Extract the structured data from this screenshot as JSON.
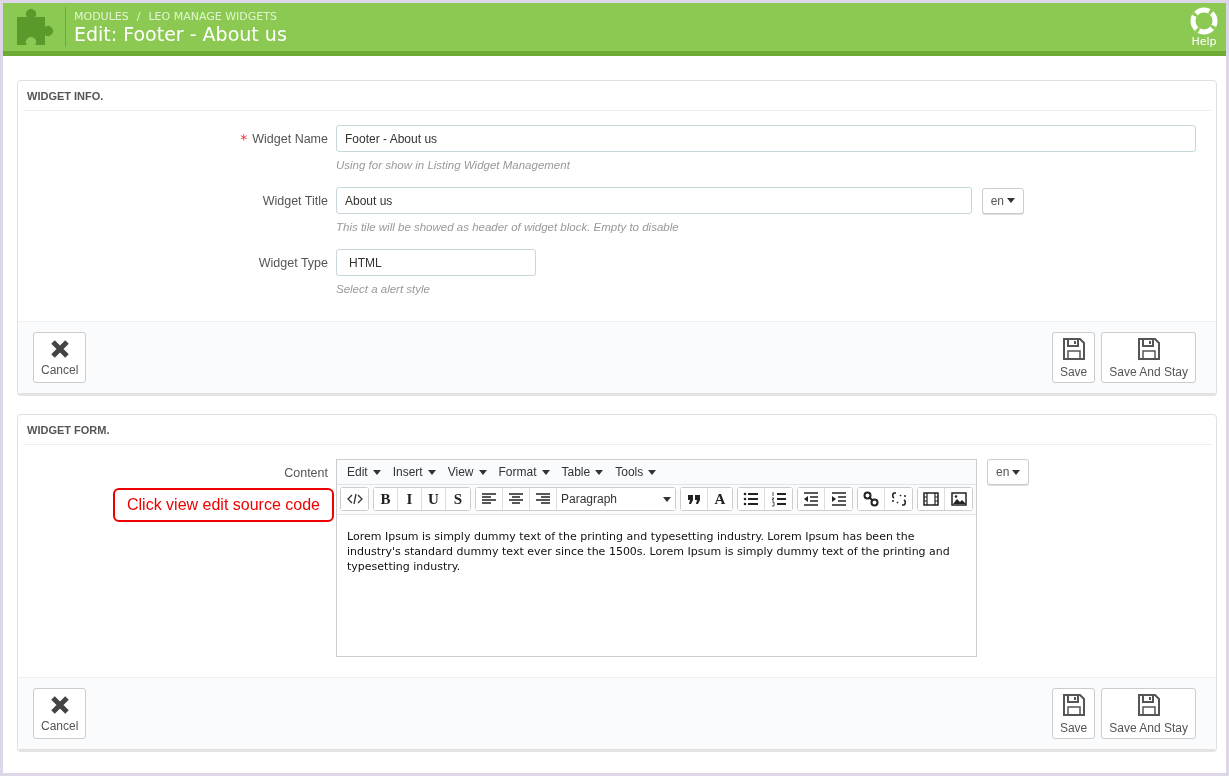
{
  "header": {
    "breadcrumb": [
      "MODULES",
      "LEO MANAGE WIDGETS"
    ],
    "separator": "/",
    "title": "Edit: Footer - About us",
    "help": "Help"
  },
  "panels": [
    {
      "heading": "WIDGET INFO.",
      "fields": [
        {
          "kind": "text",
          "label": "Widget Name",
          "required_mark": "*",
          "value": "Footer - About us",
          "hint": "Using for show in Listing Widget Management"
        },
        {
          "kind": "lang",
          "label": "Widget Title",
          "value": "About us",
          "lang": "en",
          "hint": "This tile will be showed as header of widget block. Empty to disable"
        },
        {
          "kind": "select",
          "label": "Widget Type",
          "value": "HTML",
          "hint": "Select a alert style"
        }
      ],
      "footer": {
        "cancel": "Cancel",
        "save": "Save",
        "save_stay": "Save And Stay"
      }
    },
    {
      "heading": "WIDGET FORM.",
      "fields": [
        {
          "kind": "editor",
          "label": "Content",
          "lang": "en",
          "menus": [
            "Edit",
            "Insert",
            "View",
            "Format",
            "Table",
            "Tools"
          ],
          "toolbar": [
            [
              {
                "kind": "source"
              }
            ],
            [
              {
                "kind": "text",
                "label": "B"
              },
              {
                "kind": "text",
                "label": "I"
              },
              {
                "kind": "text",
                "label": "U"
              },
              {
                "kind": "text",
                "label": "S"
              }
            ],
            [
              {
                "kind": "align-left"
              },
              {
                "kind": "align-center"
              },
              {
                "kind": "align-right"
              },
              {
                "kind": "select",
                "value": "Paragraph"
              }
            ],
            [
              {
                "kind": "quote"
              },
              {
                "kind": "text",
                "label": "A"
              }
            ],
            [
              {
                "kind": "bullets"
              },
              {
                "kind": "numbers"
              }
            ],
            [
              {
                "kind": "outdent"
              },
              {
                "kind": "indent"
              }
            ],
            [
              {
                "kind": "link"
              },
              {
                "kind": "unlink"
              }
            ],
            [
              {
                "kind": "film"
              },
              {
                "kind": "image"
              }
            ]
          ],
          "body": "Lorem Ipsum is simply dummy text of the printing and typesetting industry. Lorem Ipsum has been the industry's standard dummy text ever since the 1500s. Lorem Ipsum is simply dummy text of the printing and typesetting industry.",
          "callout": "Click view edit source code"
        }
      ],
      "footer": {
        "cancel": "Cancel",
        "save": "Save",
        "save_stay": "Save And Stay"
      }
    }
  ]
}
